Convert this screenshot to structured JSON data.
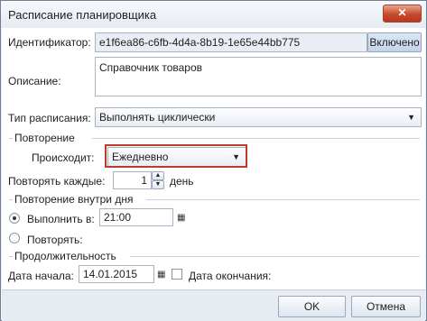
{
  "window": {
    "title": "Расписание планировщика",
    "close_icon": "✕"
  },
  "identifier": {
    "label": "Идентификатор:",
    "value": "e1f6ea86-c6fb-4d4a-8b19-1e65e44bb775",
    "toggle_label": "Включено"
  },
  "description": {
    "label": "Описание:",
    "value": "Справочник товаров"
  },
  "schedule_type": {
    "label": "Тип расписания:",
    "value": "Выполнять циклически"
  },
  "repeat": {
    "section_title": "Повторение",
    "occurs_label": "Происходит:",
    "occurs_value": "Ежедневно",
    "every_label": "Повторять каждые:",
    "every_value": "1",
    "every_unit": "день"
  },
  "intraday": {
    "section_title": "Повторение внутри дня",
    "run_at_label": "Выполнить в:",
    "run_at_value": "21:00",
    "run_at_selected": true,
    "repeat_label": "Повторять:"
  },
  "duration": {
    "section_title": "Продолжительность",
    "start_label": "Дата начала:",
    "start_value": "14.01.2015",
    "end_label": "Дата окончания:",
    "end_checked": false
  },
  "buttons": {
    "ok_label": "OK",
    "cancel_label": "Отмена"
  }
}
